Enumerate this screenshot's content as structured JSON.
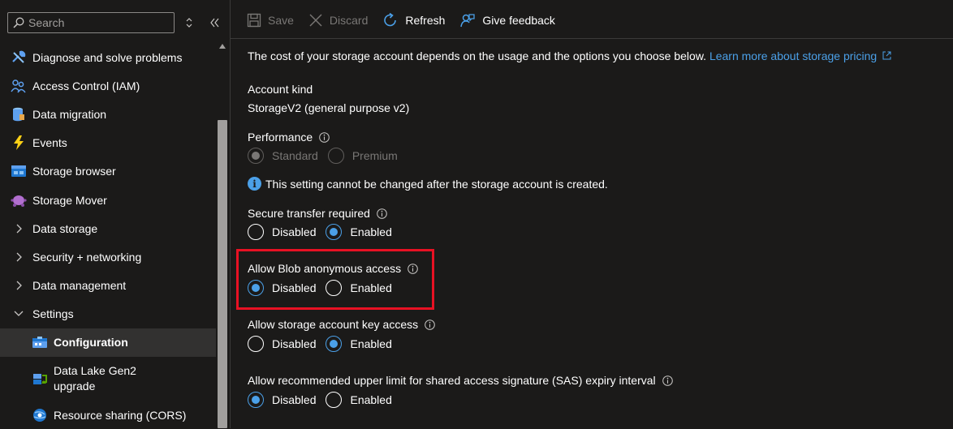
{
  "sidebar": {
    "search_placeholder": "Search",
    "items": [
      {
        "label": "Diagnose and solve problems",
        "icon": "wrench-icon"
      },
      {
        "label": "Access Control (IAM)",
        "icon": "people-icon"
      },
      {
        "label": "Data migration",
        "icon": "data-migration-icon"
      },
      {
        "label": "Events",
        "icon": "lightning-icon"
      },
      {
        "label": "Storage browser",
        "icon": "storage-browser-icon"
      },
      {
        "label": "Storage Mover",
        "icon": "storage-mover-icon"
      },
      {
        "label": "Data storage",
        "icon": "chevron-right-icon"
      },
      {
        "label": "Security + networking",
        "icon": "chevron-right-icon"
      },
      {
        "label": "Data management",
        "icon": "chevron-right-icon"
      },
      {
        "label": "Settings",
        "icon": "chevron-down-icon"
      },
      {
        "label": "Configuration",
        "icon": "configuration-icon"
      },
      {
        "label": "Data Lake Gen2 upgrade",
        "icon": "data-lake-icon"
      },
      {
        "label": "Resource sharing (CORS)",
        "icon": "cors-icon"
      }
    ]
  },
  "toolbar": {
    "save_label": "Save",
    "discard_label": "Discard",
    "refresh_label": "Refresh",
    "feedback_label": "Give feedback"
  },
  "content": {
    "intro_text": "The cost of your storage account depends on the usage and the options you choose below.",
    "intro_link": "Learn more about storage pricing",
    "account_kind_label": "Account kind",
    "account_kind_value": "StorageV2 (general purpose v2)",
    "performance_label": "Performance",
    "performance_options": [
      "Standard",
      "Premium"
    ],
    "performance_notice": "This setting cannot be changed after the storage account is created.",
    "secure_transfer_label": "Secure transfer required",
    "blob_anonymous_label": "Allow Blob anonymous access",
    "key_access_label": "Allow storage account key access",
    "sas_expiry_label": "Allow recommended upper limit for shared access signature (SAS) expiry interval",
    "option_disabled": "Disabled",
    "option_enabled": "Enabled"
  },
  "colors": {
    "accent": "#4ba0e8",
    "highlight": "#e81123",
    "background": "#1b1a19"
  }
}
